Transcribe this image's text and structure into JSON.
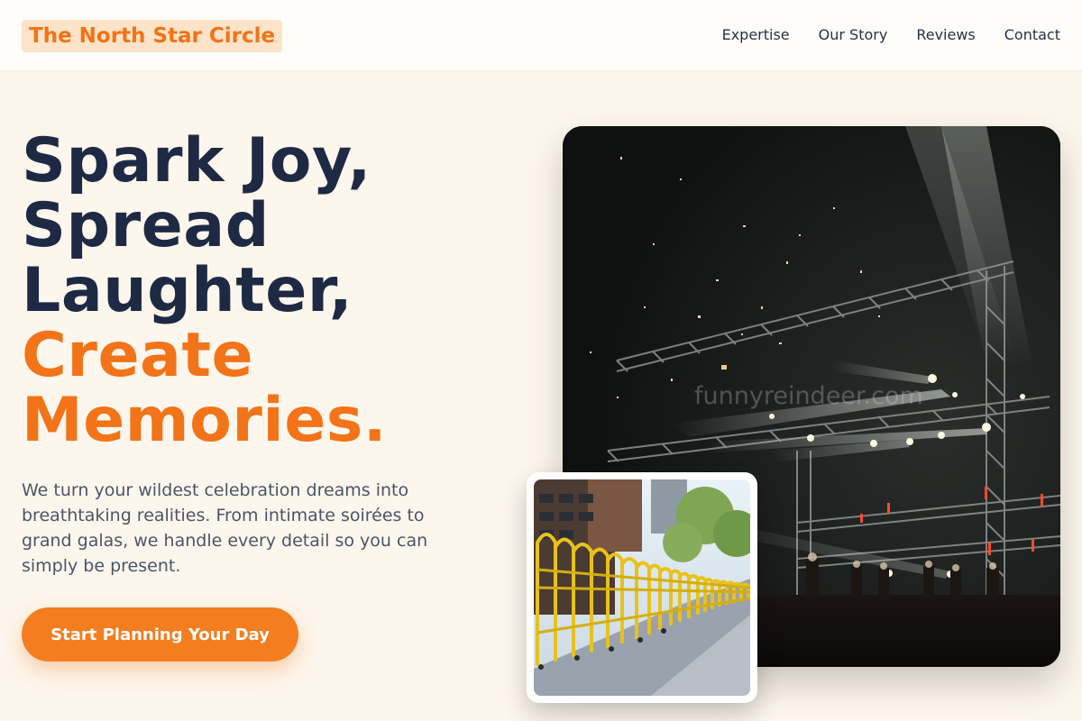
{
  "header": {
    "brand": "The North Star Circle",
    "nav": [
      "Expertise",
      "Our Story",
      "Reviews",
      "Contact"
    ]
  },
  "hero": {
    "title_dark": [
      "Spark Joy,",
      "Spread",
      "Laughter,"
    ],
    "title_accent": [
      "Create",
      "Memories."
    ],
    "description": "We turn your wildest celebration dreams into breathtaking realities. From intimate soirées to grand galas, we handle every detail so you can simply be present.",
    "cta_label": "Start Planning Your Day"
  },
  "images": {
    "main_watermark": "funnyreindeer.com"
  },
  "colors": {
    "accent": "#f27318",
    "dark_text": "#1e2a44",
    "background": "#fdf6ec"
  }
}
